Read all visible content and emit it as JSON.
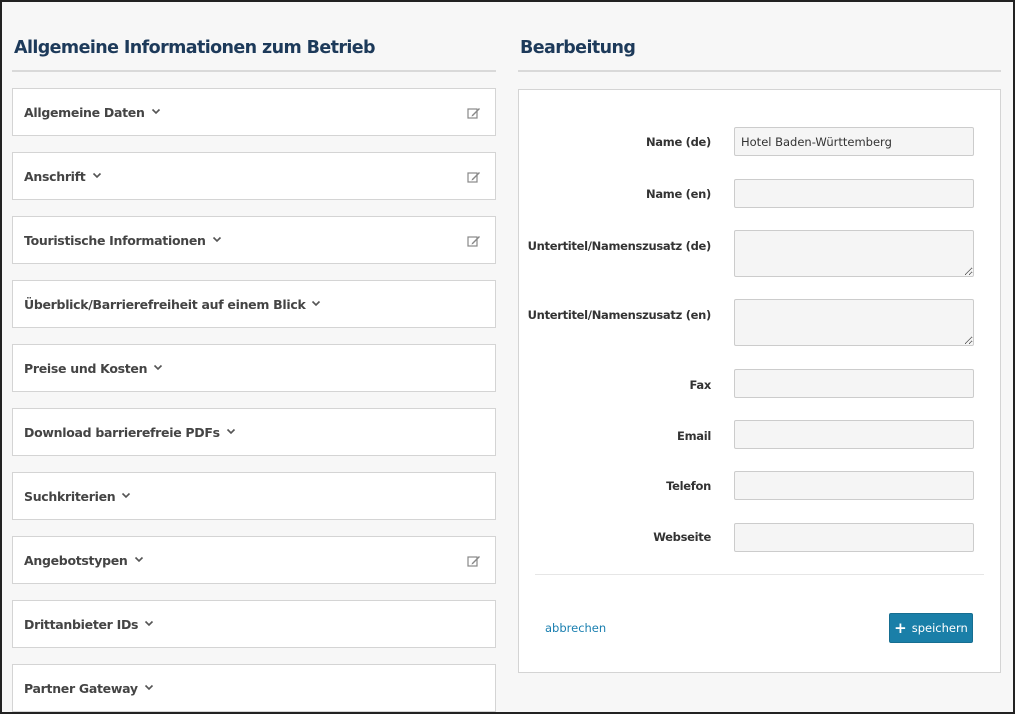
{
  "left": {
    "title": "Allgemeine Informationen zum Betrieb",
    "items": [
      {
        "label": "Allgemeine Daten",
        "editable": true
      },
      {
        "label": "Anschrift",
        "editable": true
      },
      {
        "label": "Touristische Informationen",
        "editable": true
      },
      {
        "label": "Überblick/Barrierefreiheit auf einem Blick",
        "editable": false
      },
      {
        "label": "Preise und Kosten",
        "editable": false
      },
      {
        "label": "Download barrierefreie PDFs",
        "editable": false
      },
      {
        "label": "Suchkriterien",
        "editable": false
      },
      {
        "label": "Angebotstypen",
        "editable": true
      },
      {
        "label": "Drittanbieter IDs",
        "editable": false
      },
      {
        "label": "Partner Gateway",
        "editable": false
      }
    ]
  },
  "right": {
    "title": "Bearbeitung",
    "fields": {
      "name_de": {
        "label": "Name (de)",
        "value": "Hotel Baden-Württemberg"
      },
      "name_en": {
        "label": "Name (en)",
        "value": ""
      },
      "subtitle_de": {
        "label": "Untertitel/Namenszusatz (de)",
        "value": ""
      },
      "subtitle_en": {
        "label": "Untertitel/Namenszusatz (en)",
        "value": ""
      },
      "fax": {
        "label": "Fax",
        "value": ""
      },
      "email": {
        "label": "Email",
        "value": ""
      },
      "telefon": {
        "label": "Telefon",
        "value": ""
      },
      "webseite": {
        "label": "Webseite",
        "value": ""
      }
    },
    "cancel_label": "abbrechen",
    "save_label": "speichern"
  },
  "colors": {
    "heading": "#1d3a5a",
    "accent": "#1a7fa8",
    "link": "#1a7fb0"
  },
  "icons": {
    "expand": "chevron-down-icon",
    "edit": "edit-icon",
    "save": "plus-icon"
  }
}
